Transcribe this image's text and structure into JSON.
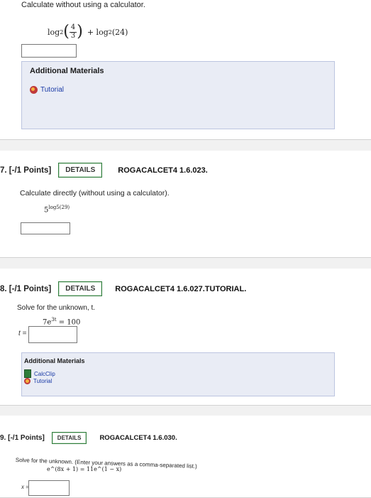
{
  "q1": {
    "prompt": "Calculate without using a calculator.",
    "expression": {
      "log_a": "log",
      "base_a": "2",
      "frac_num": "4",
      "frac_den": "3",
      "plus": "+ log",
      "base_b": "2",
      "arg_b": "(24)"
    },
    "additional_materials": "Additional Materials",
    "tutorial": "Tutorial"
  },
  "q2": {
    "number": "7.",
    "points": "[-/1 Points]",
    "details": "DETAILS",
    "code": "ROGACALCET4 1.6.023.",
    "prompt": "Calculate directly (without using a calculator).",
    "expression_base": "5",
    "expression_exp": "log5(29)"
  },
  "q3": {
    "number": "8.",
    "points": "[-/1 Points]",
    "details": "DETAILS",
    "code": "ROGACALCET4 1.6.027.TUTORIAL.",
    "prompt": "Solve for the unknown, t.",
    "eq_base": "7e",
    "eq_exp": "3t",
    "eq_rhs": "= 100",
    "var_label": "t =",
    "additional_materials": "Additional Materials",
    "calcclip": "CalcClip",
    "tutorial": "Tutorial"
  },
  "q4": {
    "number": "9.",
    "points": "[-/1 Points]",
    "details": "DETAILS",
    "code": "ROGACALCET4 1.6.030.",
    "prompt": "Solve for the unknown. (Enter your answers as a comma-separated list.)",
    "equation": "e^(8x + 1) = 11e^(1 − x)",
    "var_label": "x ="
  }
}
